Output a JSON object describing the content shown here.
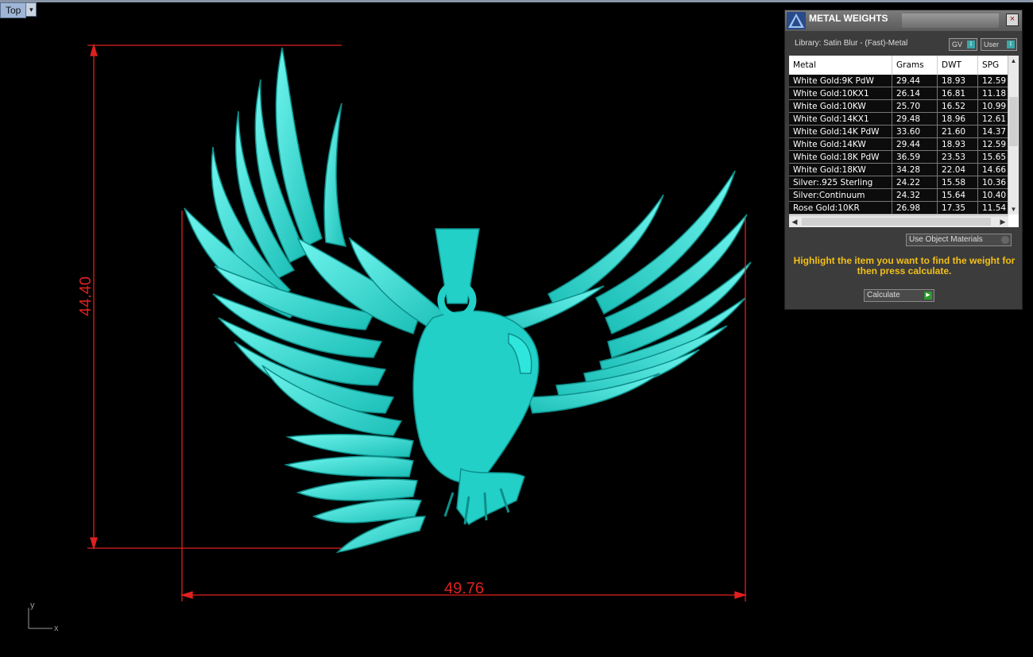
{
  "viewport": {
    "name": "Top",
    "menu_arrow": "▾"
  },
  "dimensions": {
    "height_label": "44.40",
    "width_label": "49.76",
    "color": "#e02020"
  },
  "axis": {
    "y": "y",
    "x": "x"
  },
  "model": {
    "subject": "eagle pendant",
    "color": "#2ee6dc"
  },
  "panel": {
    "title": "METAL WEIGHTS",
    "close": "×",
    "library": "Library: Satin Blur - (Fast)-Metal",
    "toggle_gv": "GV",
    "toggle_user": "User",
    "columns": [
      "Metal",
      "Grams",
      "DWT",
      "SPG"
    ],
    "rows": [
      [
        "White Gold:9K PdW",
        "29.44",
        "18.93",
        "12.59"
      ],
      [
        "White Gold:10KX1",
        "26.14",
        "16.81",
        "11.18"
      ],
      [
        "White Gold:10KW",
        "25.70",
        "16.52",
        "10.99"
      ],
      [
        "White Gold:14KX1",
        "29.48",
        "18.96",
        "12.61"
      ],
      [
        "White Gold:14K PdW",
        "33.60",
        "21.60",
        "14.37"
      ],
      [
        "White Gold:14KW",
        "29.44",
        "18.93",
        "12.59"
      ],
      [
        "White Gold:18K PdW",
        "36.59",
        "23.53",
        "15.65"
      ],
      [
        "White Gold:18KW",
        "34.28",
        "22.04",
        "14.66"
      ],
      [
        "Silver:.925 Sterling",
        "24.22",
        "15.58",
        "10.36"
      ],
      [
        "Silver:Continuum",
        "24.32",
        "15.64",
        "10.40"
      ],
      [
        "Rose Gold:10KR",
        "26.98",
        "17.35",
        "11.54"
      ]
    ],
    "use_object_materials": "Use Object Materials",
    "message": "Highlight the item you want to find the weight for then press calculate.",
    "calculate": "Calculate"
  }
}
